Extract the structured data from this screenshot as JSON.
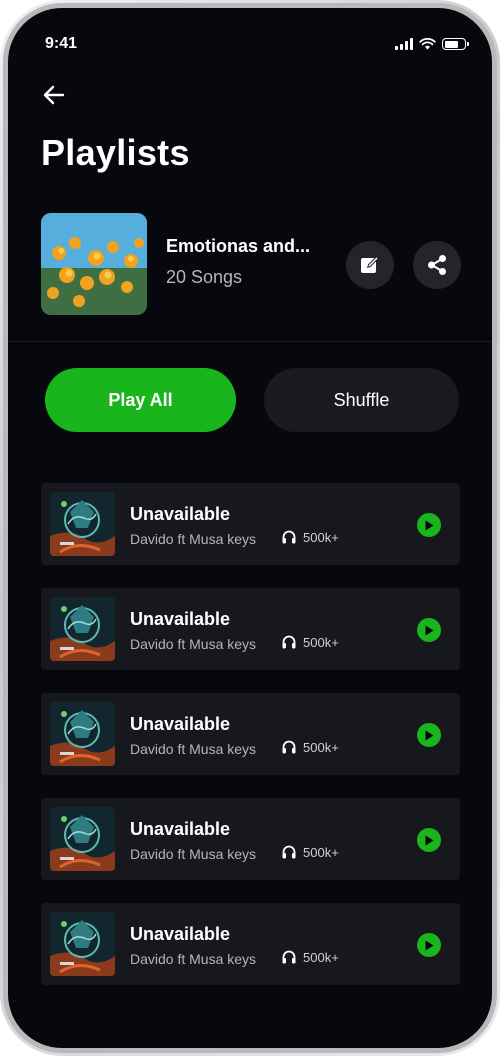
{
  "status_bar": {
    "time": "9:41"
  },
  "header": {
    "title": "Playlists"
  },
  "playlist": {
    "name": "Emotionas and...",
    "song_count": "20 Songs"
  },
  "actions": {
    "play_all_label": "Play All",
    "shuffle_label": "Shuffle"
  },
  "tracks": [
    {
      "title": "Unavailable",
      "artist": "Davido ft Musa keys",
      "listens": "500k+"
    },
    {
      "title": "Unavailable",
      "artist": "Davido ft Musa keys",
      "listens": "500k+"
    },
    {
      "title": "Unavailable",
      "artist": "Davido ft Musa keys",
      "listens": "500k+"
    },
    {
      "title": "Unavailable",
      "artist": "Davido ft Musa keys",
      "listens": "500k+"
    },
    {
      "title": "Unavailable",
      "artist": "Davido ft Musa keys",
      "listens": "500k+"
    }
  ],
  "icons": {
    "back": "arrow-left-icon",
    "edit": "edit-icon",
    "share": "share-icon",
    "listens": "headphones-icon",
    "play": "play-icon"
  },
  "colors": {
    "background": "#07080d",
    "accent": "#1ab41c",
    "card": "#17181e",
    "muted_text": "#b5b5bb"
  }
}
